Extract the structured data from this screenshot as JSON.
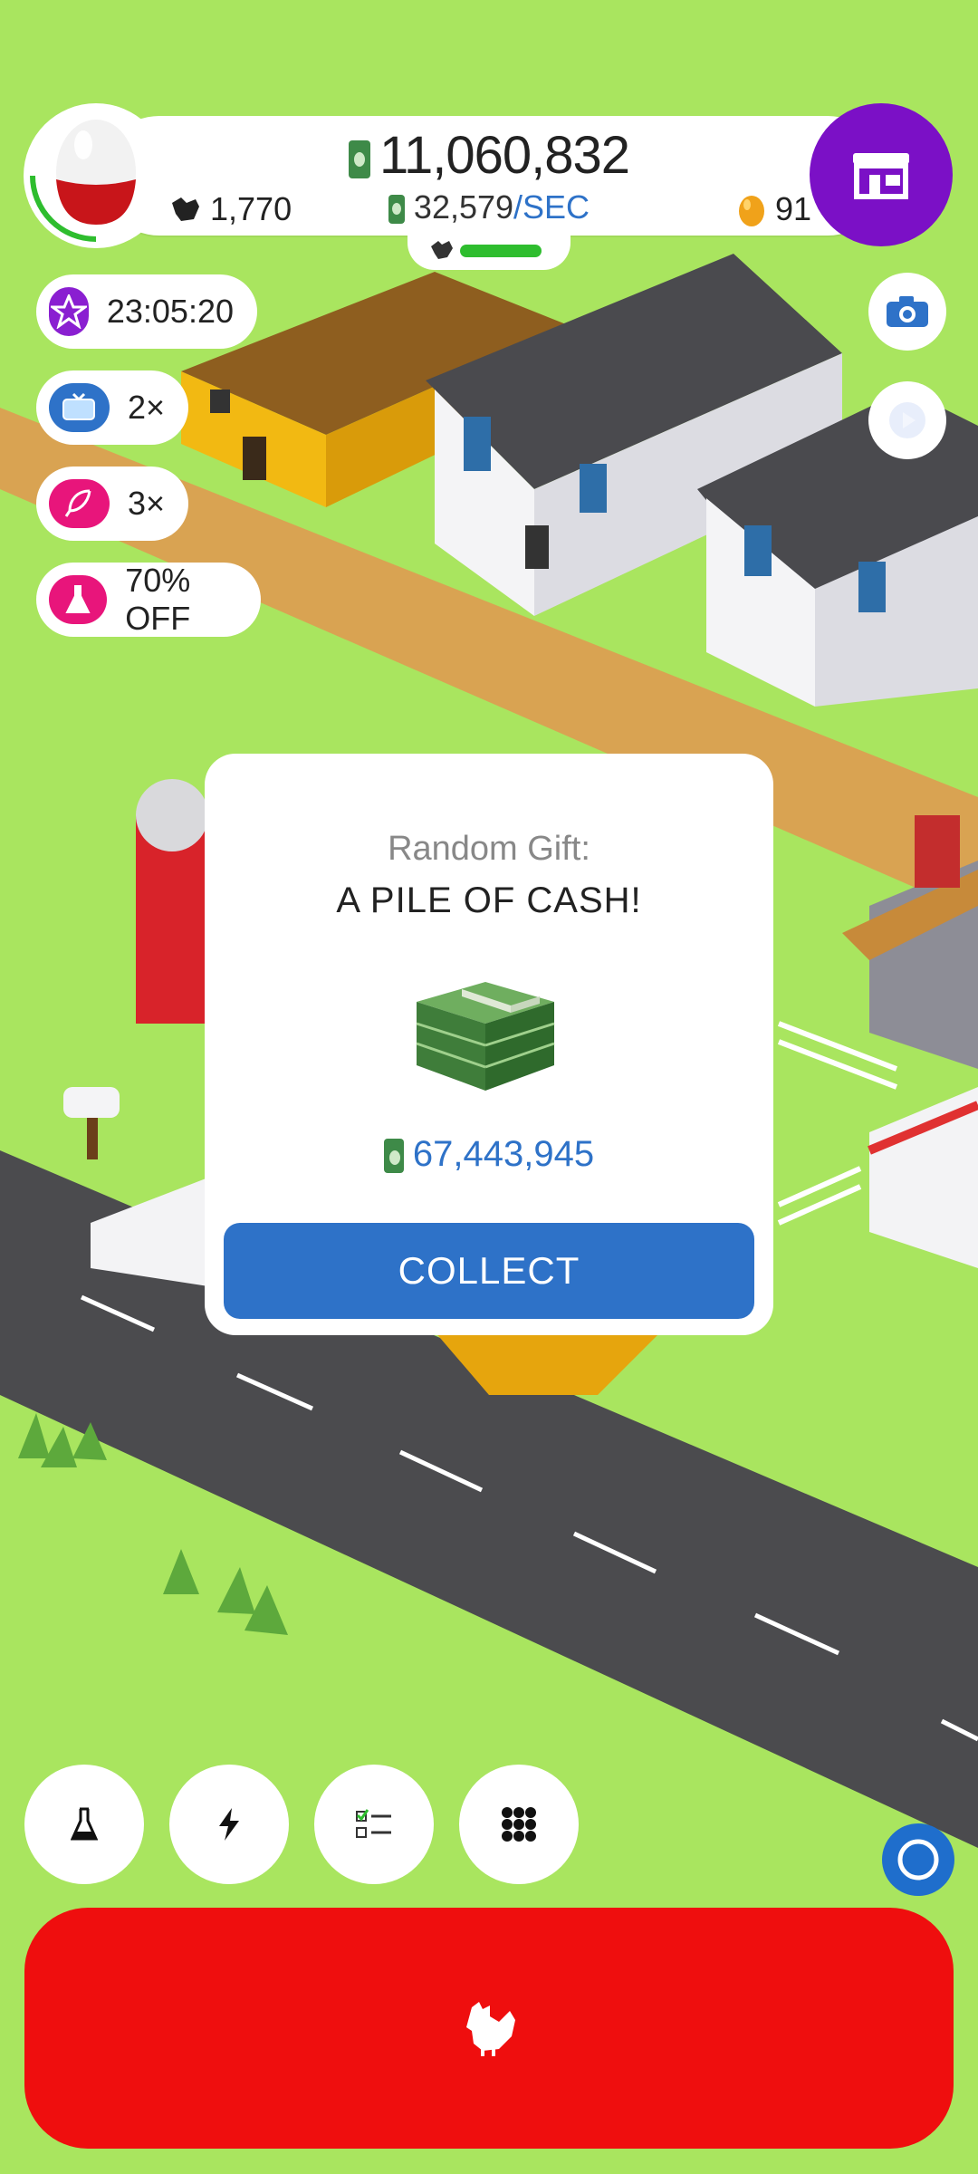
{
  "hud": {
    "money": "11,060,832",
    "rate_value": "32,579",
    "rate_unit": "/SEC",
    "chicken_count": "1,770",
    "golden_eggs": "91",
    "shop_icon": "shop-icon",
    "egg_icon": "egg-icon"
  },
  "boosts": [
    {
      "icon": "star-icon",
      "label": "23:05:20",
      "color": "#8a1fd1"
    },
    {
      "icon": "tv-icon",
      "label": "2×",
      "color": "#2e72c8"
    },
    {
      "icon": "feather-icon",
      "label": "3×",
      "color": "#e8157b"
    },
    {
      "icon": "flask-icon",
      "label": "70% OFF",
      "color": "#e8157b"
    }
  ],
  "side_buttons": {
    "camera": "camera-icon",
    "video": "video-play-icon"
  },
  "modal": {
    "label": "Random Gift:",
    "title": "A PILE OF CASH!",
    "amount": "67,443,945",
    "collect": "COLLECT",
    "image": "cash-pile-icon"
  },
  "bottom_nav": [
    {
      "icon": "flask-icon"
    },
    {
      "icon": "lightning-icon"
    },
    {
      "icon": "checklist-icon"
    },
    {
      "icon": "grid-icon"
    }
  ],
  "hatch_button": {
    "icon": "chicken-icon"
  },
  "colors": {
    "grass": "#a9e55f",
    "shop": "#7b10c6",
    "hatch": "#ef0e0e",
    "accent_blue": "#2e72c8"
  }
}
